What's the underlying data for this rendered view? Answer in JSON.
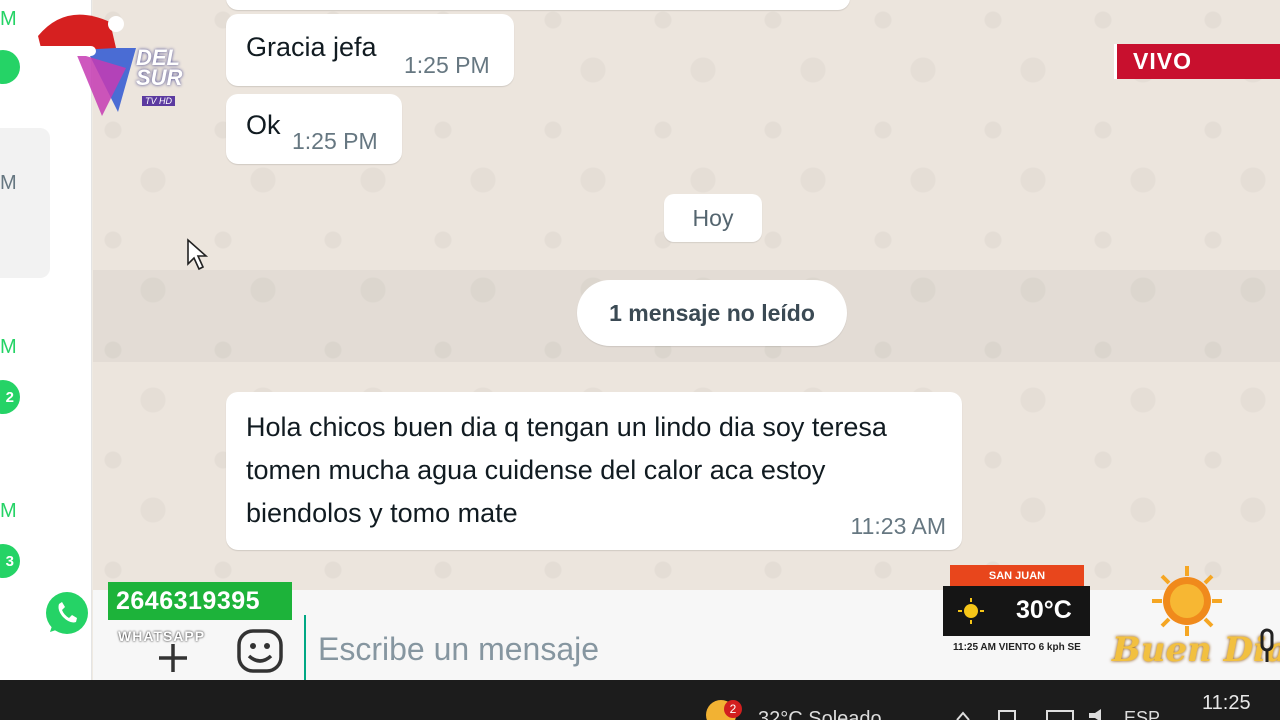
{
  "chat_list": {
    "items": [
      {
        "time_suffix": "M",
        "badge": ""
      },
      {
        "time_suffix": "M",
        "badge": ""
      },
      {
        "time_suffix": "M",
        "badge": "2"
      },
      {
        "time_suffix": "M",
        "badge": "3"
      }
    ]
  },
  "messages": [
    {
      "text": "Gracia jefa",
      "time": "1:25 PM"
    },
    {
      "text": "Ok",
      "time": "1:25 PM"
    },
    {
      "text": "Hola chicos buen dia q tengan un lindo dia soy teresa tomen mucha agua cuidense del calor aca estoy biendolos y tomo mate",
      "time": "11:23 AM"
    }
  ],
  "date_divider": "Hoy",
  "unread_notice": "1 mensaje no leído",
  "input": {
    "placeholder": "Escribe un mensaje"
  },
  "overlay": {
    "channel_line1": "DEL",
    "channel_line2": "SUR",
    "channel_sub": "TV HD",
    "live_label": "VIVO",
    "whatsapp_number": "2646319395",
    "whatsapp_label": "WHATSAPP",
    "weather_city": "SAN JUAN",
    "weather_temp": "30°C",
    "weather_details": "11:25 AM   VIENTO   6 kph SE",
    "show_brand": "Buen Dia"
  },
  "taskbar": {
    "weather": "32°C  Soleado",
    "weather_badge": "2",
    "lang": "ESP",
    "clock": "11:25"
  },
  "colors": {
    "whatsapp_green": "#25d366",
    "live_red": "#c8102e",
    "weather_orange": "#e8461c"
  }
}
